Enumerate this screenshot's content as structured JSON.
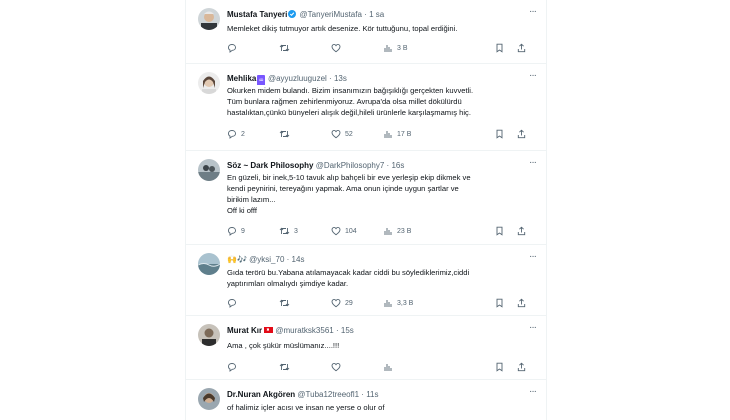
{
  "tweets": [
    {
      "name": "Mustafa Tanyeri",
      "verified": true,
      "handle": "@TanyeriMustafa",
      "time": "1 sa",
      "text": "Memleket dikiş tutmuyor artık desenize. Kör tuttuğunu, topal erdiğini.",
      "replies": "",
      "retweets": "",
      "likes": "",
      "views": "3 B"
    },
    {
      "name": "Mehlika",
      "name_emoji": "♒",
      "handle": "@ayyuzluuguzel",
      "time": "13s",
      "text": "Okurken midem bulandı. Bizim insanımızın bağışıklığı gerçekten kuvvetli.\nTüm bunlara rağmen zehirlenmiyoruz. Avrupa'da olsa millet dökülürdü\nhastalıktan,çünkü bünyeleri alışık değil,hileli ürünlerle karşılaşmamış hiç.",
      "replies": "2",
      "retweets": "",
      "likes": "52",
      "views": "17 B"
    },
    {
      "name": "Söz ~ Dark Philosophy",
      "handle": "@DarkPhilosophy7",
      "time": "16s",
      "text": "En güzeli, bir inek,5-10 tavuk alıp bahçeli bir eve yerleşip ekip dikmek ve\nkendi peynirini, tereyağını yapmak. Ama onun içinde uygun şartlar ve\nbirikim lazım...\nOff ki offf",
      "replies": "9",
      "retweets": "3",
      "likes": "104",
      "views": "23 B"
    },
    {
      "name": "🙌🎶",
      "handle": "@yksi_70",
      "time": "14s",
      "text": "Gıda terörü bu.Yabana atılamayacak kadar ciddi bu söylediklerimiz,ciddi\nyaptırımları olmalıydı şimdiye kadar.",
      "replies": "",
      "retweets": "",
      "likes": "29",
      "views": "3,3 B"
    },
    {
      "name": "Murat Kır",
      "handle": "@muratksk3561",
      "time": "15s",
      "text": "Ama , çok şükür müslümanız....!!!",
      "replies": "",
      "retweets": "",
      "likes": "",
      "views": ""
    },
    {
      "name": "Dr.Nuran Akgören",
      "handle": "@Tuba12treeofl1",
      "time": "11s",
      "text": "of halimiz içler acısı ve insan ne yerse o olur of",
      "replies": "",
      "retweets": "",
      "likes": "",
      "views": ""
    }
  ],
  "sep": "·",
  "more_label": "···",
  "colors": {
    "verified": "#1d9bf0",
    "secondary": "#536471",
    "text": "#0f1419"
  }
}
